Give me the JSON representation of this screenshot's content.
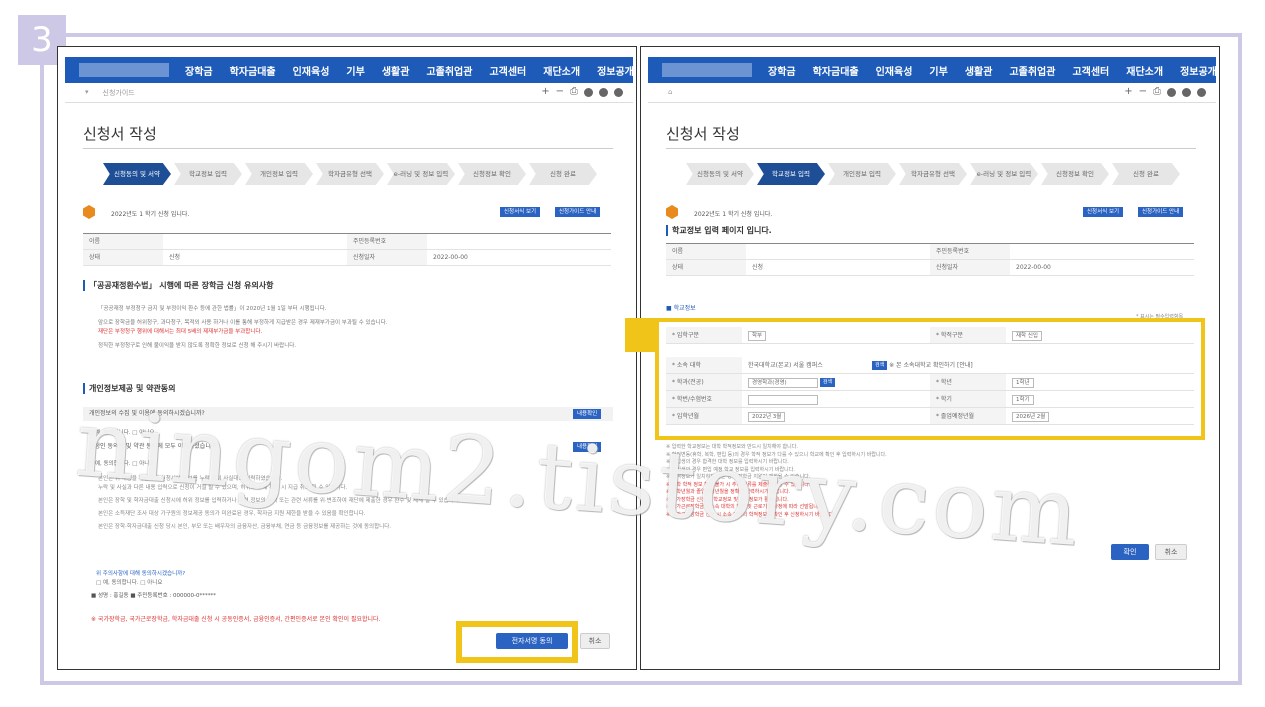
{
  "step_number": "3",
  "nav": {
    "menu": [
      "장학금",
      "학자금대출",
      "인재육성",
      "기부",
      "생활관",
      "고졸취업관",
      "고객센터",
      "재단소개",
      "정보공개"
    ]
  },
  "subnav": {
    "crumbs": [
      "신청가이드"
    ],
    "icons": [
      "+",
      "−",
      "print-icon",
      "facebook-icon",
      "twitter-icon",
      "blog-icon"
    ]
  },
  "left": {
    "page_title": "신청서 작성",
    "steps": [
      "신청동의 및 서약",
      "학교정보 입력",
      "개인정보 입력",
      "학자금유형 선택",
      "e-러닝 및 정보 입력",
      "신청정보 확인",
      "신청 완료"
    ],
    "active_step": 0,
    "notice": "2022년도 1 학기 신청 입니다.",
    "notice_btn1": "신청서식 보기",
    "notice_btn2": "신청가이드 안내",
    "info_rows": [
      {
        "k1": "이름",
        "v1": "",
        "k2": "주민등록번호",
        "v2": ""
      },
      {
        "k1": "상태",
        "v1": "신청",
        "k2": "신청일자",
        "v2": "2022-00-00"
      }
    ],
    "section1_title": "「공공재정환수법」 시행에 따른 장학금 신청 유의사항",
    "section1_lines": [
      "「공공재정 부정청구 금지 및 부정이익 환수 등에 관한 법률」이 2020년 1월 1일 부터 시행됩니다.",
      "앞으로 장학금을 허위청구, 과다청구, 목적외 사용 하거나 이를 통해 부정하게 지급받은 경우 제재부가금이 부과될 수 있습니다.",
      "재단은 부정청구 행위에 대해서는 최대 5배의 제재부가금을 부과합니다.",
      "정직한 부정청구로 인해 불이익을 받지 않도록 정확한 정보로 신청 해 주시기 바랍니다."
    ],
    "section2_title": "개인정보제공 및 약관동의",
    "agree1": "개인정보의 수집 및 이용에 동의하시겠습니까?",
    "agree1_btn": "내용확인",
    "agree1_opts": "□ 예, 동의합니다.   □ 아니요",
    "agree2": "신청인 동의서 및 약관 동의에 모두 이해하셨습니까?",
    "agree2_btn": "내용확인",
    "agree2_opts": "□ 예, 동의합니다.   □ 아니요",
    "body_lines": [
      "본인은 위 내용을 확인하여 신청서에 정보를 누락 없이 사실대로 입력하였습니다.",
      "누락 및 사실과 다른 내용 입력으로 신청이 거절 될 수 있으며, 허위로 수혜 확인 시 지급 취소 될 수 있습니다.",
      "본인은 장학 및 학자금대출 신청시에 허위 정보를 입력하거나 관련 정보의 누락 또는 관련 서류를 위·변조하여 재단에 제출한 경우 환수 및 제재 될 수 있습니다.",
      "본인은 소득재단 조사 대상 가구원의 정보제공 동의가 미완료된 경우, 학자금 지원 제한을 받을 수 있음을 확인합니다.",
      "본인은 장학·학자금대출 신청 당시 본인, 부모 또는 배우자의 금융자산, 금융부채, 연금 등 금융정보를 제공하는 것에 동의합니다."
    ],
    "q3": "위 주의사항에 대해 동의하시겠습니까?",
    "q3_opts": "□ 예, 동의합니다.   □ 아니요",
    "id_line": "■ 성명 : 홍길동    ■ 주민등록번호 : 000000-0******",
    "warning": "※ 국가장학금, 국가근로장학금, 학자금대출 신청 시 공동인증서, 금융인증서, 간편인증서로 본인 확인이 필요합니다.",
    "primary_btn": "전자서명 동의",
    "cancel_btn": "취소"
  },
  "right": {
    "page_title": "신청서 작성",
    "steps": [
      "신청동의 및 서약",
      "학교정보 입력",
      "개인정보 입력",
      "학자금유형 선택",
      "e-러닝 및 정보 입력",
      "신청정보 확인",
      "신청 완료"
    ],
    "active_step": 1,
    "notice": "2022년도 1 학기 신청 입니다.",
    "notice_btn1": "신청서식 보기",
    "notice_btn2": "신청가이드 안내",
    "heading": "학교정보 입력 페이지 입니다.",
    "info_rows": [
      {
        "k1": "이름",
        "v1": "",
        "k2": "주민등록번호",
        "v2": ""
      },
      {
        "k1": "상태",
        "v1": "신청",
        "k2": "신청일자",
        "v2": "2022-00-00"
      }
    ],
    "school_section": "■ 학교정보",
    "required_note": "* 표시는 필수입력항목",
    "form": {
      "row1": {
        "k1": "* 입학구분",
        "v1": "학부",
        "k2": "* 학적구분",
        "v2": "재학 신입"
      },
      "row2": {
        "k1": "* 소속 대학",
        "v1": "한국대학교(본교) 서울 캠퍼스",
        "btn": "검색",
        "k2": "",
        "v2": "※ 본 소속대학교 확인하기 [안내]"
      },
      "row3": {
        "k1": "* 학과(전공)",
        "v1": "경영학과(경영)",
        "btn": "검색",
        "k2": "* 학년",
        "v2": "1학년"
      },
      "row4": {
        "k1": "* 학번/수험번호",
        "v1": "",
        "k2": "* 학기",
        "v2": "1학기"
      },
      "row5": {
        "k1": "* 입학년월",
        "v1": "2022년 3월",
        "k2": "* 졸업예정년월",
        "v2": "2026년 2월"
      }
    },
    "notes": [
      "※ 입력한 학교정보는 대학 학적정보와 반드시 일치해야 합니다.",
      "※ 학적변동(휴학, 복학, 편입 등)의 경우 학적 정보가 다를 수 있으니 학교에 확인 후 입력하시기 바랍니다.",
      "※ 신입생의 경우 합격한 대학 정보를 입력하시기 바랍니다.",
      "※ 편입생의 경우 편입 예정 학교 정보를 입력하시기 바랍니다.",
      "※ 학적정보가 일치하지 않는 경우 장학금 지원이 제한될 수 있습니다.",
      "※ 대학 학적 정보 확인 불가 시 추가 서류를 제출해야 할 수 있습니다.",
      "※ 입학년월과 졸업예정년월을 정확히 입력하시기 바랍니다.",
      "※ 국가장학금 신청 시 학교정보 및 소득정보가 활용됩니다.",
      "※ 국가근로장학금은 소속 대학의 학칙 및 근로기관 사정에 따라 선발됩니다.",
      "※ 국가근로장학금 신청 시 소속 대학의 학적정보를 확인 후 신청하시기 바랍니다."
    ],
    "confirm_btn": "확인",
    "cancel_btn": "취소"
  },
  "watermark": "ningom2.tistory.com"
}
